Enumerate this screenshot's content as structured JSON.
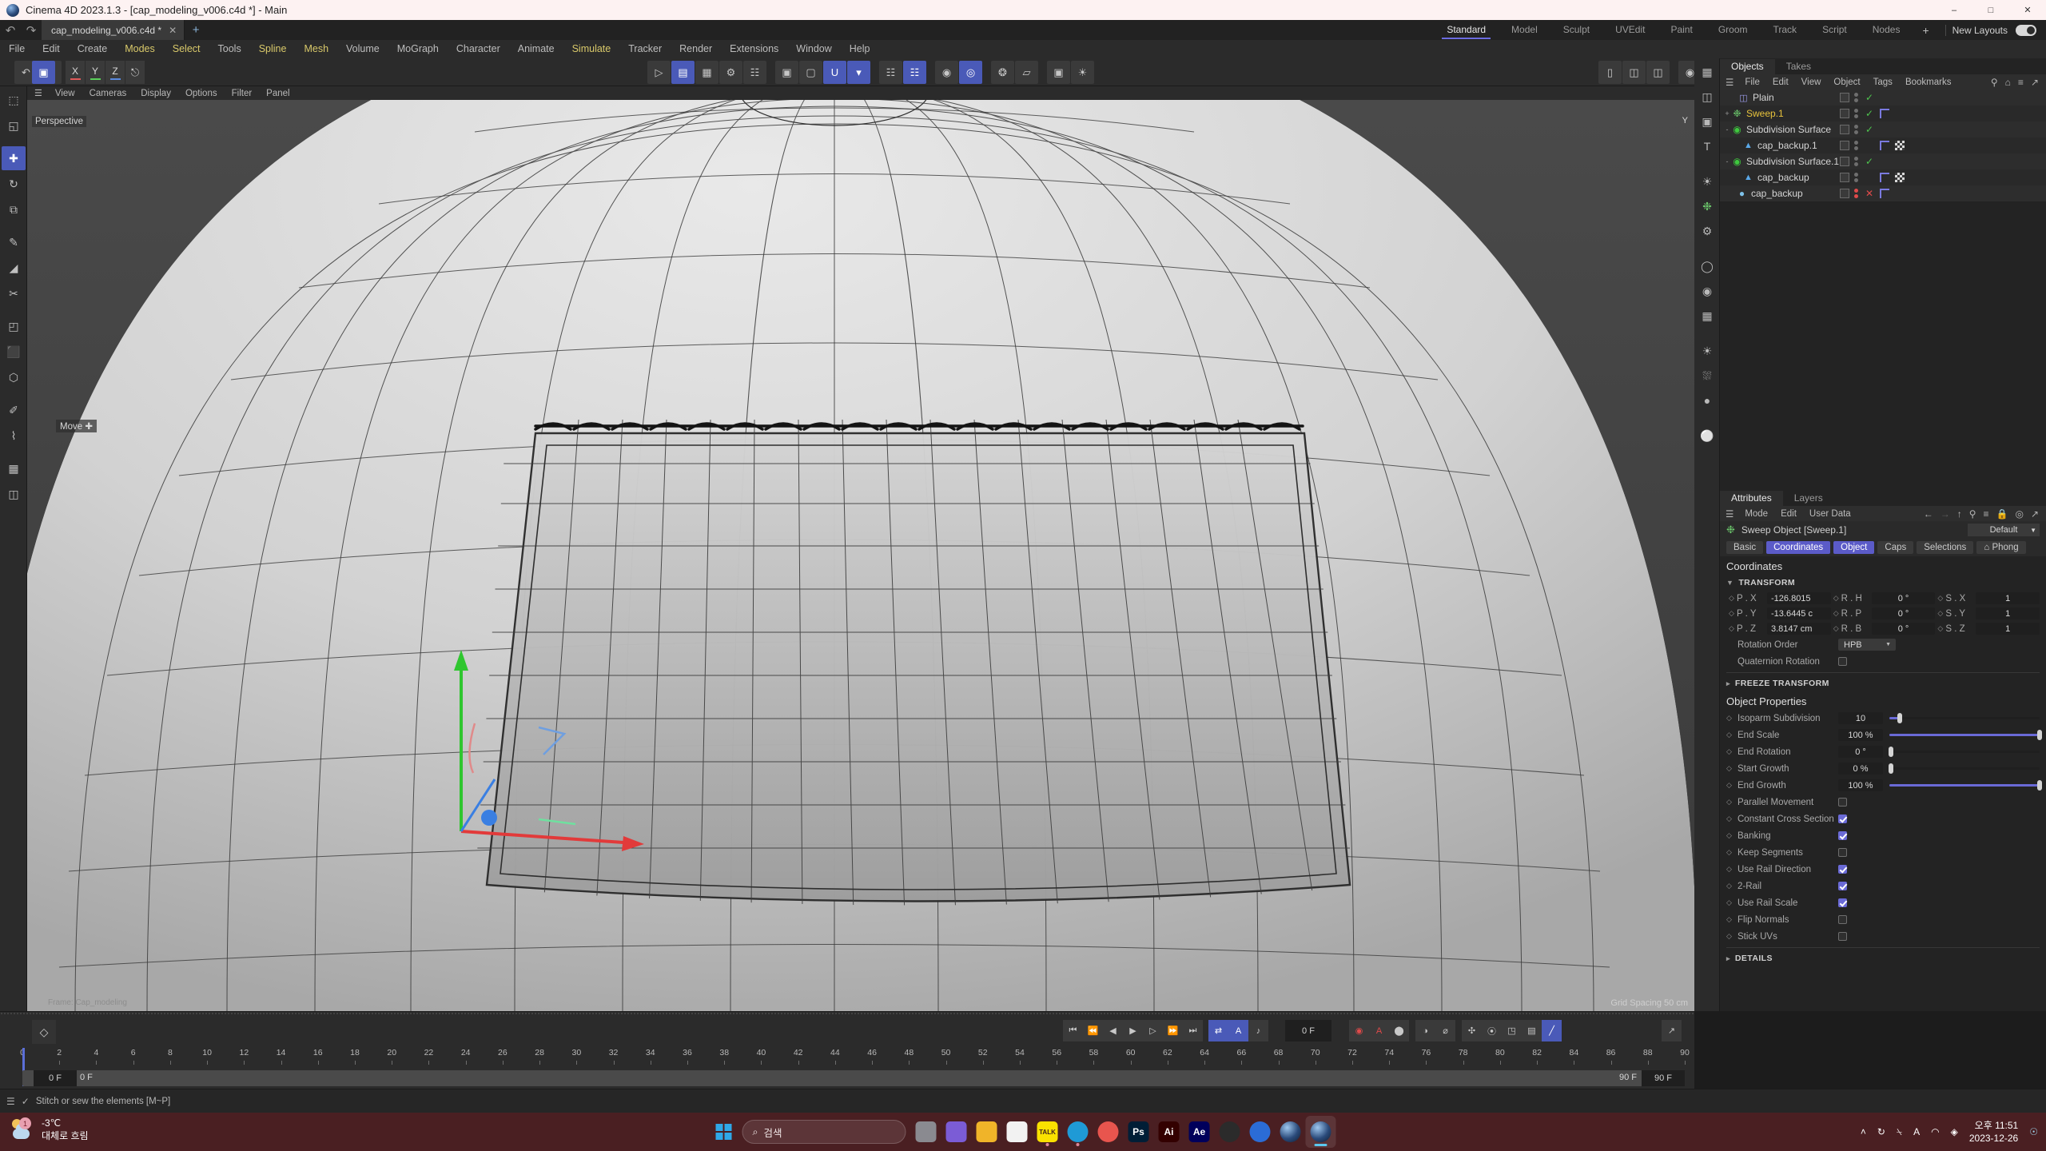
{
  "window": {
    "title": "Cinema 4D 2023.1.3 - [cap_modeling_v006.c4d *] - Main",
    "minimize": "–",
    "maximize": "□",
    "close": "✕"
  },
  "doctabs": {
    "undo": "↶",
    "redo": "↷",
    "tab_label": "cap_modeling_v006.c4d *",
    "close": "✕",
    "add": "+"
  },
  "menu": {
    "items": [
      {
        "label": "File",
        "hl": false
      },
      {
        "label": "Edit",
        "hl": false
      },
      {
        "label": "Create",
        "hl": false
      },
      {
        "label": "Modes",
        "hl": true
      },
      {
        "label": "Select",
        "hl": true
      },
      {
        "label": "Tools",
        "hl": false
      },
      {
        "label": "Spline",
        "hl": true
      },
      {
        "label": "Mesh",
        "hl": true
      },
      {
        "label": "Volume",
        "hl": false
      },
      {
        "label": "MoGraph",
        "hl": false
      },
      {
        "label": "Character",
        "hl": false
      },
      {
        "label": "Animate",
        "hl": false
      },
      {
        "label": "Simulate",
        "hl": true
      },
      {
        "label": "Tracker",
        "hl": false
      },
      {
        "label": "Render",
        "hl": false
      },
      {
        "label": "Extensions",
        "hl": false
      },
      {
        "label": "Window",
        "hl": false
      },
      {
        "label": "Help",
        "hl": false
      }
    ]
  },
  "layouts": {
    "tabs": [
      "Standard",
      "Model",
      "Sculpt",
      "UVEdit",
      "Paint",
      "Groom",
      "Track",
      "Script",
      "Nodes"
    ],
    "active": "Standard",
    "plus": "+",
    "new_layouts_label": "New Layouts"
  },
  "toolbar": {
    "undo_redo": [
      "↶",
      "↷"
    ],
    "axis_buttons": [
      "X",
      "Y",
      "Z"
    ],
    "axis_colors": [
      "#e05a5a",
      "#5ad05a",
      "#5a8ae0"
    ],
    "object_axis_icon": "┗",
    "mode_icons": [
      "◯",
      "⬤",
      "◉",
      "⬟",
      "⬢",
      "▣"
    ],
    "select_icons": [
      "▭",
      "▭"
    ],
    "snap_label": "U",
    "magnet_label": "⬚",
    "workplane_label": "⊞",
    "render_icons": [
      "▦",
      "▣",
      "▤"
    ],
    "layout_icon": "⬚"
  },
  "left_tools": {
    "items": [
      {
        "name": "selection-tool",
        "glyph": "⬚",
        "sel": false
      },
      {
        "name": "live-selection-tool",
        "glyph": "◱",
        "sel": false
      },
      {
        "name": "move-tool",
        "glyph": "✚",
        "sel": true
      },
      {
        "name": "rotate-tool",
        "glyph": "↻",
        "sel": false
      },
      {
        "name": "scale-tool",
        "glyph": "⧉",
        "sel": false
      },
      {
        "name": "paint-tool",
        "glyph": "✎",
        "sel": false
      },
      {
        "name": "brush-tool",
        "glyph": "◢",
        "sel": false
      },
      {
        "name": "knife-tool",
        "glyph": "✂",
        "sel": false
      },
      {
        "name": "bevel-tool",
        "glyph": "◰",
        "sel": false
      },
      {
        "name": "extrude-tool",
        "glyph": "⬛",
        "sel": false
      },
      {
        "name": "weld-tool",
        "glyph": "⬡",
        "sel": false
      },
      {
        "name": "polygon-pen-tool",
        "glyph": "✐",
        "sel": false
      },
      {
        "name": "spline-tool",
        "glyph": "⌇",
        "sel": false
      },
      {
        "name": "array-tool",
        "glyph": "▦",
        "sel": false
      },
      {
        "name": "workplane-tool",
        "glyph": "◫",
        "sel": false
      }
    ]
  },
  "viewport": {
    "menu": [
      "View",
      "Cameras",
      "Display",
      "Options",
      "Filter",
      "Panel"
    ],
    "view_label": "Perspective",
    "move_hint": "Move",
    "grid_info": "Grid Spacing   50 cm",
    "axis_tag": "Y",
    "frame_note": "Frame: Cap_modeling"
  },
  "object_manager": {
    "tabs": [
      "Objects",
      "Takes"
    ],
    "active_tab": "Objects",
    "menu": [
      "File",
      "Edit",
      "View",
      "Object",
      "Tags",
      "Bookmarks"
    ],
    "icons": [
      "search-icon",
      "home-icon",
      "filter-icon",
      "popout-icon"
    ],
    "rows": [
      {
        "name": "Plain",
        "twirl": "",
        "indent": 12,
        "icon": "field",
        "state": "check",
        "selected": false,
        "tags": [],
        "dots": "gray"
      },
      {
        "name": "Sweep.1",
        "twirl": "+",
        "indent": 4,
        "icon": "sweep",
        "state": "check",
        "selected": true,
        "tags": [
          "corner"
        ],
        "dots": "gray"
      },
      {
        "name": "Subdivision Surface",
        "twirl": "-",
        "indent": 4,
        "icon": "subd",
        "state": "check",
        "selected": false,
        "tags": [],
        "dots": "gray"
      },
      {
        "name": "cap_backup.1",
        "twirl": "",
        "indent": 18,
        "icon": "poly",
        "state": "",
        "selected": false,
        "tags": [
          "corner",
          "checker"
        ],
        "dots": "gray"
      },
      {
        "name": "Subdivision Surface.1",
        "twirl": "-",
        "indent": 4,
        "icon": "subd",
        "state": "check",
        "selected": false,
        "tags": [],
        "dots": "gray"
      },
      {
        "name": "cap_backup",
        "twirl": "",
        "indent": 18,
        "icon": "poly",
        "state": "",
        "selected": false,
        "tags": [
          "corner",
          "checker"
        ],
        "dots": "gray"
      },
      {
        "name": "cap_backup",
        "twirl": "",
        "indent": 10,
        "icon": "sphere",
        "state": "x",
        "selected": false,
        "tags": [
          "corner"
        ],
        "dots": "red"
      }
    ]
  },
  "attributes": {
    "tabs": [
      "Attributes",
      "Layers"
    ],
    "active_tab": "Attributes",
    "menu": [
      "Mode",
      "Edit",
      "User Data"
    ],
    "object_title": "Sweep Object [Sweep.1]",
    "preset": "Default",
    "prop_tabs": [
      {
        "label": "Basic",
        "on": false
      },
      {
        "label": "Coordinates",
        "on": true
      },
      {
        "label": "Object",
        "on": true
      },
      {
        "label": "Caps",
        "on": false
      },
      {
        "label": "Selections",
        "on": false
      },
      {
        "label": "⌂ Phong",
        "on": false
      }
    ],
    "coordinates_title": "Coordinates",
    "transform_fold": "TRANSFORM",
    "transform": [
      {
        "plabel": "P . X",
        "pvalue": "-126.8015",
        "rlabel": "R . H",
        "rvalue": "0 °",
        "slabel": "S . X",
        "svalue": "1"
      },
      {
        "plabel": "P . Y",
        "pvalue": "-13.6445 c",
        "rlabel": "R . P",
        "rvalue": "0 °",
        "slabel": "S . Y",
        "svalue": "1"
      },
      {
        "plabel": "P . Z",
        "pvalue": "3.8147 cm",
        "rlabel": "R . B",
        "rvalue": "0 °",
        "slabel": "S . Z",
        "svalue": "1"
      }
    ],
    "rotation_order_label": "Rotation Order",
    "rotation_order_value": "HPB",
    "quaternion_label": "Quaternion Rotation",
    "quaternion_checked": false,
    "freeze_fold": "FREEZE TRANSFORM",
    "object_properties_title": "Object Properties",
    "sliders": [
      {
        "label": "Isoparm Subdivision",
        "value": "10",
        "pct": 7
      },
      {
        "label": "End Scale",
        "value": "100 %",
        "pct": 100
      },
      {
        "label": "End Rotation",
        "value": "0 °",
        "pct": 1
      },
      {
        "label": "Start Growth",
        "value": "0 %",
        "pct": 1
      },
      {
        "label": "End Growth",
        "value": "100 %",
        "pct": 100
      }
    ],
    "checkboxes": [
      {
        "label": "Parallel Movement",
        "checked": false
      },
      {
        "label": "Constant Cross Section",
        "checked": true
      },
      {
        "label": "Banking",
        "checked": true
      },
      {
        "label": "Keep Segments",
        "checked": false
      },
      {
        "label": "Use Rail Direction",
        "checked": true
      },
      {
        "label": "2-Rail",
        "checked": true
      },
      {
        "label": "Use Rail Scale",
        "checked": true
      },
      {
        "label": "Flip Normals",
        "checked": false
      },
      {
        "label": "Stick UVs",
        "checked": false
      }
    ],
    "details_fold": "DETAILS"
  },
  "timeline": {
    "key_icon": "◇",
    "transport": [
      "⏮",
      "⏪",
      "◀",
      "▶",
      "▷",
      "⏩",
      "⏭"
    ],
    "loop_icon": "⇄",
    "autokey_icon": "A",
    "sound_icon": "♪",
    "current_frame": "0 F",
    "record_icons": [
      "◉",
      "A",
      "⬤"
    ],
    "key_icons": [
      "◑",
      "⌀"
    ],
    "extra_icons": [
      "✣",
      "⦿",
      "◳",
      "▤",
      "╱"
    ],
    "start_frame": "0 F",
    "end_frame": "90 F",
    "inner_start": "0 F",
    "inner_end": "90 F",
    "tick_start": 0,
    "tick_end": 90,
    "tick_step": 2,
    "axis_icon": "↗"
  },
  "statusbar": {
    "message": "Stitch or sew the elements [M~P]",
    "menu_icon": "☰",
    "check_icon": "✓"
  },
  "taskbar": {
    "weather_temp": "-3℃",
    "weather_desc": "대체로 흐림",
    "weather_badge": "1",
    "search_placeholder": "검색",
    "search_icon": "⌕",
    "apps": [
      {
        "name": "task-view",
        "label": "",
        "bg": "#8a8a90"
      },
      {
        "name": "widgets",
        "label": "",
        "bg": "#7b5cd6"
      },
      {
        "name": "file-explorer",
        "label": "",
        "bg": "#f0b429"
      },
      {
        "name": "microsoft-store",
        "label": "",
        "bg": "#f2f2f2"
      },
      {
        "name": "kakaotalk",
        "label": "TALK",
        "bg": "#fae100"
      },
      {
        "name": "microsoft-edge",
        "label": "",
        "bg": "#1f9ad6"
      },
      {
        "name": "chrome-app",
        "label": "",
        "bg": "#e8554e"
      },
      {
        "name": "photoshop",
        "label": "Ps",
        "bg": "#001e36"
      },
      {
        "name": "illustrator",
        "label": "Ai",
        "bg": "#330000"
      },
      {
        "name": "after-effects",
        "label": "Ae",
        "bg": "#00005b"
      },
      {
        "name": "acrobat",
        "label": "",
        "bg": "#2b2b2b"
      },
      {
        "name": "zbrush",
        "label": "",
        "bg": "#2b6cd6"
      },
      {
        "name": "cinema4d-1",
        "label": "",
        "bg": "#1d3f66"
      },
      {
        "name": "cinema4d-2",
        "label": "",
        "bg": "#1d3f66"
      }
    ],
    "tray_icons": [
      "˄",
      "↻",
      "⍀",
      "A",
      "◠",
      "◈"
    ],
    "time": "오후 11:51",
    "date": "2023-12-26",
    "bell": "🔔"
  }
}
